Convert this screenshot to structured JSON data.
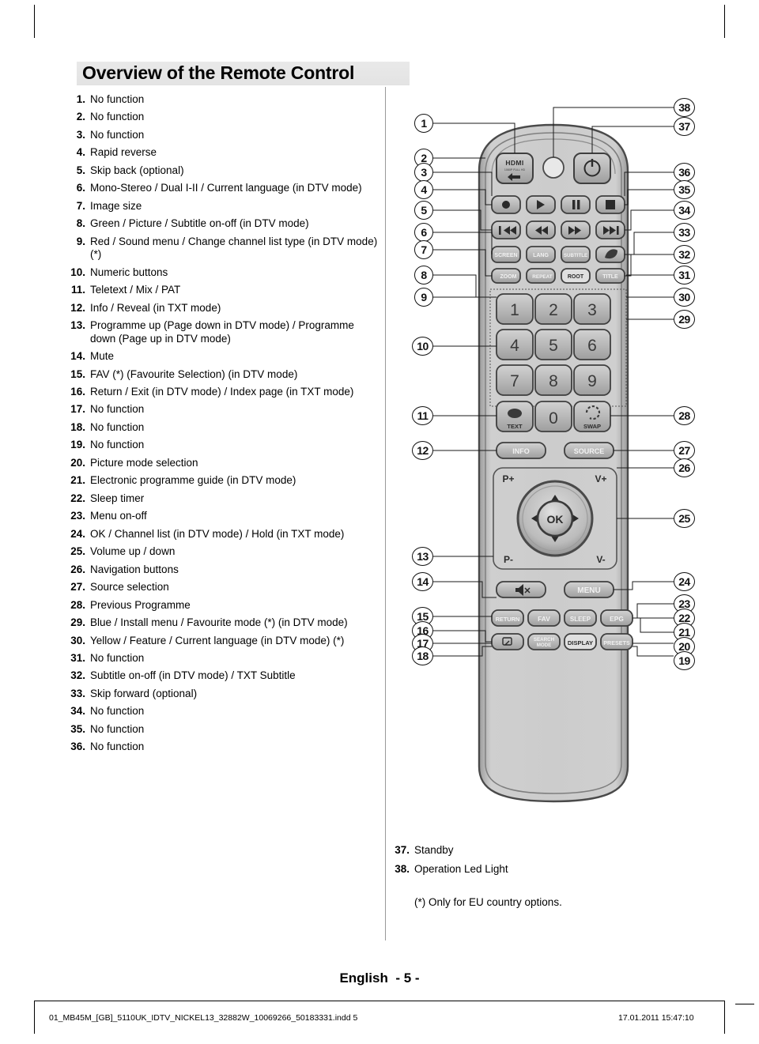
{
  "document": {
    "heading": "Overview of the Remote Control",
    "language_footer": "English",
    "page_number": "- 5 -",
    "footer_file": "01_MB45M_[GB]_5110UK_IDTV_NICKEL13_32882W_10069266_50183331.indd   5",
    "footer_timestamp": "17.01.2011   15:47:10",
    "footnote": "(*) Only for EU country options."
  },
  "legend_left": [
    {
      "num": "1.",
      "text": "No function"
    },
    {
      "num": "2.",
      "text": "No function"
    },
    {
      "num": "3.",
      "text": "No function"
    },
    {
      "num": "4.",
      "text": "Rapid reverse"
    },
    {
      "num": "5.",
      "text": "Skip back (optional)"
    },
    {
      "num": "6.",
      "text": "Mono-Stereo / Dual I-II / Current language (in DTV mode)"
    },
    {
      "num": "7.",
      "text": "Image size"
    },
    {
      "num": "8.",
      "text": "Green / Picture / Subtitle on-off (in DTV mode)"
    },
    {
      "num": "9.",
      "text": "Red / Sound menu / Change channel list type (in DTV mode) (*)"
    },
    {
      "num": "10.",
      "text": "Numeric buttons"
    },
    {
      "num": "11.",
      "text": "Teletext / Mix / PAT"
    },
    {
      "num": "12.",
      "text": "Info / Reveal (in TXT mode)"
    },
    {
      "num": "13.",
      "text": "Programme up (Page down in DTV mode) / Programme down (Page up in DTV mode)"
    },
    {
      "num": "14.",
      "text": "Mute"
    },
    {
      "num": "15.",
      "text": "FAV (*) (Favourite Selection) (in DTV mode)"
    },
    {
      "num": "16.",
      "text": "Return / Exit (in DTV mode) / Index page (in TXT mode)"
    },
    {
      "num": "17.",
      "text": "No function"
    },
    {
      "num": "18.",
      "text": "No function"
    },
    {
      "num": "19.",
      "text": "No function"
    },
    {
      "num": "20.",
      "text": "Picture mode selection"
    },
    {
      "num": "21.",
      "text": "Electronic programme guide (in DTV mode)"
    },
    {
      "num": "22.",
      "text": "Sleep timer"
    },
    {
      "num": "23.",
      "text": "Menu on-off"
    },
    {
      "num": "24.",
      "text": "OK / Channel list (in DTV mode) / Hold (in TXT mode)"
    },
    {
      "num": "25.",
      "text": "Volume up / down"
    },
    {
      "num": "26.",
      "text": "Navigation buttons"
    },
    {
      "num": "27.",
      "text": "Source selection"
    },
    {
      "num": "28.",
      "text": "Previous Programme"
    },
    {
      "num": "29.",
      "text": "Blue / Install menu / Favourite mode (*) (in DTV mode)"
    },
    {
      "num": "30.",
      "text": "Yellow / Feature / Current language (in DTV mode) (*)"
    },
    {
      "num": "31.",
      "text": "No function"
    },
    {
      "num": "32.",
      "text": "Subtitle on-off (in DTV mode) / TXT Subtitle"
    },
    {
      "num": "33.",
      "text": "Skip forward (optional)"
    },
    {
      "num": "34.",
      "text": "No function"
    },
    {
      "num": "35.",
      "text": "No function"
    },
    {
      "num": "36.",
      "text": "No function"
    }
  ],
  "legend_right": [
    {
      "num": "37.",
      "text": "Standby"
    },
    {
      "num": "38.",
      "text": "Operation Led Light"
    }
  ],
  "remote": {
    "callouts_left": [
      "1",
      "2",
      "3",
      "4",
      "5",
      "6",
      "7",
      "8",
      "9",
      "10",
      "11",
      "12",
      "13",
      "14",
      "15",
      "16",
      "17",
      "18"
    ],
    "callouts_right": [
      "38",
      "37",
      "36",
      "35",
      "34",
      "33",
      "32",
      "31",
      "30",
      "29",
      "28",
      "27",
      "26",
      "25",
      "24",
      "23",
      "22",
      "21",
      "20",
      "19"
    ],
    "buttons": {
      "hdmi": "HDMI",
      "hdmi_sub": "1080P FULL HD",
      "led": "led-indicator",
      "power": "power",
      "record": "record",
      "play": "play",
      "pause": "pause",
      "stop": "stop",
      "skip_back": "skip-back",
      "rewind": "rewind",
      "forward": "fast-forward",
      "skip_forward": "skip-forward",
      "screen": "SCREEN",
      "lang": "LANG",
      "subtitle": "SUBTITLE",
      "leaf": "eco-leaf",
      "zoom": "ZOOM",
      "repeat": "REPEAT",
      "root": "ROOT",
      "title": "TITLE",
      "keypad": [
        "1",
        "2",
        "3",
        "4",
        "5",
        "6",
        "7",
        "8",
        "9"
      ],
      "text": "TEXT",
      "zero": "0",
      "swap": "SWAP",
      "info": "INFO",
      "source": "SOURCE",
      "p_up": "P+",
      "p_down": "P-",
      "v_up": "V+",
      "v_down": "V-",
      "ok": "OK",
      "mute": "mute",
      "menu": "MENU",
      "return": "RETURN",
      "fav": "FAV",
      "sleep": "SLEEP",
      "epg": "EPG",
      "picture_mode": "picture-mode",
      "search_mode_l1": "SEARCH",
      "search_mode_l2": "MODE",
      "display": "DISPLAY",
      "presets": "PRESETS"
    },
    "colors": {
      "body": "#c9c9c9",
      "button": "#b4b4b4",
      "outline": "#3a3a3a",
      "leader": "#1a1a1a"
    }
  }
}
